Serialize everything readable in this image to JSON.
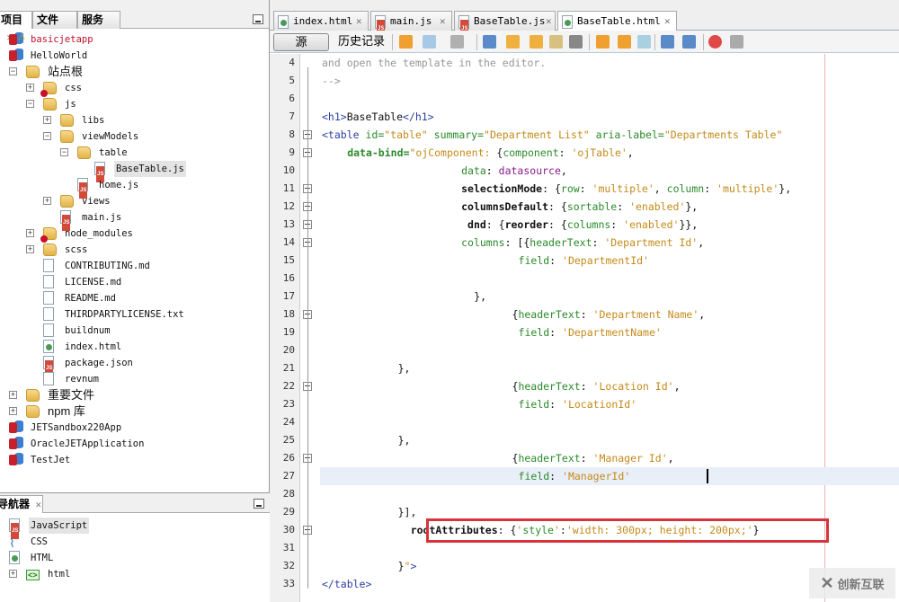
{
  "project_panel": {
    "tabs": [
      {
        "label": "项目",
        "closable": true
      },
      {
        "label": "文件"
      },
      {
        "label": "服务"
      }
    ],
    "minimize_icon": "minimize-icon",
    "tree": [
      {
        "label": "basicjetapp",
        "icon": "project-warning-icon",
        "depth": 0,
        "style": "red",
        "toggle": "+"
      },
      {
        "label": "HelloWorld",
        "icon": "project-icon",
        "depth": 0,
        "toggle": "-"
      },
      {
        "label": "站点根",
        "icon": "site-root-folder-icon",
        "depth": 1,
        "toggle": "-",
        "cn": true
      },
      {
        "label": "css",
        "icon": "folder-error-icon",
        "depth": 2,
        "toggle": "+"
      },
      {
        "label": "js",
        "icon": "folder-icon",
        "depth": 2,
        "toggle": "-"
      },
      {
        "label": "libs",
        "icon": "folder-icon",
        "depth": 3,
        "toggle": "+"
      },
      {
        "label": "viewModels",
        "icon": "folder-icon",
        "depth": 3,
        "toggle": "-"
      },
      {
        "label": "table",
        "icon": "folder-icon",
        "depth": 4,
        "toggle": "-"
      },
      {
        "label": "BaseTable.js",
        "icon": "js-file-icon",
        "depth": 5,
        "selected": true
      },
      {
        "label": "home.js",
        "icon": "js-file-icon",
        "depth": 4
      },
      {
        "label": "views",
        "icon": "folder-icon",
        "depth": 3,
        "toggle": "+"
      },
      {
        "label": "main.js",
        "icon": "js-file-icon",
        "depth": 3
      },
      {
        "label": "node_modules",
        "icon": "folder-error-icon",
        "depth": 2,
        "toggle": "+"
      },
      {
        "label": "scss",
        "icon": "folder-icon",
        "depth": 2,
        "toggle": "+"
      },
      {
        "label": "CONTRIBUTING.md",
        "icon": "file-icon",
        "depth": 2
      },
      {
        "label": "LICENSE.md",
        "icon": "file-icon",
        "depth": 2
      },
      {
        "label": "README.md",
        "icon": "file-icon",
        "depth": 2
      },
      {
        "label": "THIRDPARTYLICENSE.txt",
        "icon": "file-icon",
        "depth": 2
      },
      {
        "label": "buildnum",
        "icon": "file-icon",
        "depth": 2
      },
      {
        "label": "index.html",
        "icon": "html-file-icon",
        "depth": 2
      },
      {
        "label": "package.json",
        "icon": "js-file-icon",
        "depth": 2
      },
      {
        "label": "revnum",
        "icon": "file-icon",
        "depth": 2
      },
      {
        "label": "重要文件",
        "icon": "important-files-icon",
        "depth": 1,
        "toggle": "+",
        "cn": true
      },
      {
        "label": "npm 库",
        "icon": "npm-library-icon",
        "depth": 1,
        "toggle": "+",
        "cn": true
      },
      {
        "label": "JETSandbox220App",
        "icon": "project-icon",
        "depth": 0,
        "toggle": "+"
      },
      {
        "label": "OracleJETApplication",
        "icon": "project-icon",
        "depth": 0,
        "toggle": "+"
      },
      {
        "label": "TestJet",
        "icon": "project-icon",
        "depth": 0,
        "toggle": "+"
      }
    ]
  },
  "navigator_panel": {
    "tab": {
      "label": "导航器",
      "closable": true
    },
    "tree": [
      {
        "label": "JavaScript",
        "icon": "js-file-icon",
        "depth": 0,
        "selected": true
      },
      {
        "label": "CSS",
        "icon": "css-icon",
        "depth": 0
      },
      {
        "label": "HTML",
        "icon": "html-file-icon",
        "depth": 0
      },
      {
        "label": "html",
        "icon": "html-element-icon",
        "depth": 1,
        "toggle": "+"
      }
    ]
  },
  "editor": {
    "tabs": [
      {
        "label": "index.html",
        "icon": "html-file-icon"
      },
      {
        "label": "main.js",
        "icon": "js-file-icon"
      },
      {
        "label": "BaseTable.js",
        "icon": "js-file-icon"
      },
      {
        "label": "BaseTable.html",
        "icon": "html-file-icon",
        "active": true
      }
    ],
    "toolbar": {
      "source_label": "源",
      "history_label": "历史记录",
      "icons": [
        "last-edit-icon",
        "back-icon",
        "forward-icon",
        "find-icon",
        "find-previous-icon",
        "find-next-icon",
        "toggle-highlight-icon",
        "toggle-rect-select-icon",
        "previous-bookmark-icon",
        "next-bookmark-icon",
        "toggle-bookmark-icon",
        "shift-left-icon",
        "shift-right-icon",
        "record-macro-icon",
        "stop-macro-icon"
      ]
    },
    "current_line": 27,
    "lines": [
      {
        "n": 4,
        "tokens": [
          [
            "c-cmt",
            "and open the template in the editor."
          ]
        ]
      },
      {
        "n": 5,
        "tokens": [
          [
            "c-cmt",
            "-->"
          ]
        ]
      },
      {
        "n": 6,
        "tokens": []
      },
      {
        "n": 7,
        "tokens": [
          [
            "c-tag",
            "<h1>"
          ],
          [
            "c-black",
            "BaseTable"
          ],
          [
            "c-tag",
            "</h1>"
          ]
        ]
      },
      {
        "n": 8,
        "tokens": [
          [
            "c-tag",
            "<table "
          ],
          [
            "c-attr",
            "id="
          ],
          [
            "c-str",
            "\"table\" "
          ],
          [
            "c-attr",
            "summary="
          ],
          [
            "c-str",
            "\"Department List\" "
          ],
          [
            "c-attr",
            "aria-label="
          ],
          [
            "c-str",
            "\"Departments Table\""
          ]
        ]
      },
      {
        "n": 9,
        "indent": 4,
        "tokens": [
          [
            "c-bold c-green",
            "data-bind="
          ],
          [
            "c-str",
            "\"ojComponent: "
          ],
          [
            "c-black",
            "{"
          ],
          [
            "c-green",
            "component"
          ],
          [
            "c-black",
            ": "
          ],
          [
            "c-str",
            "'ojTable'"
          ],
          [
            "c-black",
            ","
          ]
        ]
      },
      {
        "n": 10,
        "indent": 22,
        "tokens": [
          [
            "c-green",
            "data"
          ],
          [
            "c-black",
            ": "
          ],
          [
            "c-purple",
            "datasource"
          ],
          [
            "c-black",
            ","
          ]
        ]
      },
      {
        "n": 11,
        "indent": 22,
        "tokens": [
          [
            "c-bold",
            "selectionMode"
          ],
          [
            "c-black",
            ": {"
          ],
          [
            "c-green",
            "row"
          ],
          [
            "c-black",
            ": "
          ],
          [
            "c-str",
            "'multiple'"
          ],
          [
            "c-black",
            ", "
          ],
          [
            "c-green",
            "column"
          ],
          [
            "c-black",
            ": "
          ],
          [
            "c-str",
            "'multiple'"
          ],
          [
            "c-black",
            "},"
          ]
        ]
      },
      {
        "n": 12,
        "indent": 22,
        "tokens": [
          [
            "c-bold",
            "columnsDefault"
          ],
          [
            "c-black",
            ": {"
          ],
          [
            "c-green",
            "sortable"
          ],
          [
            "c-black",
            ": "
          ],
          [
            "c-str",
            "'enabled'"
          ],
          [
            "c-black",
            "},"
          ]
        ]
      },
      {
        "n": 13,
        "indent": 22,
        "tokens": [
          [
            "c-bold",
            " dnd"
          ],
          [
            "c-black",
            ": {"
          ],
          [
            "c-bold",
            "reorder"
          ],
          [
            "c-black",
            ": {"
          ],
          [
            "c-green",
            "columns"
          ],
          [
            "c-black",
            ": "
          ],
          [
            "c-str",
            "'enabled'"
          ],
          [
            "c-black",
            "}},"
          ]
        ]
      },
      {
        "n": 14,
        "indent": 22,
        "tokens": [
          [
            "c-green",
            "columns"
          ],
          [
            "c-black",
            ": [{"
          ],
          [
            "c-green",
            "headerText"
          ],
          [
            "c-black",
            ": "
          ],
          [
            "c-str",
            "'Department Id'"
          ],
          [
            "c-black",
            ","
          ]
        ]
      },
      {
        "n": 15,
        "indent": 31,
        "tokens": [
          [
            "c-green",
            "field"
          ],
          [
            "c-black",
            ": "
          ],
          [
            "c-str",
            "'DepartmentId'"
          ]
        ]
      },
      {
        "n": 16,
        "tokens": []
      },
      {
        "n": 17,
        "indent": 24,
        "tokens": [
          [
            "c-black",
            "},"
          ]
        ]
      },
      {
        "n": 18,
        "indent": 30,
        "tokens": [
          [
            "c-black",
            "{"
          ],
          [
            "c-green",
            "headerText"
          ],
          [
            "c-black",
            ": "
          ],
          [
            "c-str",
            "'Department Name'"
          ],
          [
            "c-black",
            ","
          ]
        ]
      },
      {
        "n": 19,
        "indent": 31,
        "tokens": [
          [
            "c-green",
            "field"
          ],
          [
            "c-black",
            ": "
          ],
          [
            "c-str",
            "'DepartmentName'"
          ]
        ]
      },
      {
        "n": 20,
        "tokens": []
      },
      {
        "n": 21,
        "indent": 12,
        "tokens": [
          [
            "c-black",
            "},"
          ]
        ]
      },
      {
        "n": 22,
        "indent": 30,
        "tokens": [
          [
            "c-black",
            "{"
          ],
          [
            "c-green",
            "headerText"
          ],
          [
            "c-black",
            ": "
          ],
          [
            "c-str",
            "'Location Id'"
          ],
          [
            "c-black",
            ","
          ]
        ]
      },
      {
        "n": 23,
        "indent": 31,
        "tokens": [
          [
            "c-green",
            "field"
          ],
          [
            "c-black",
            ": "
          ],
          [
            "c-str",
            "'LocationId'"
          ]
        ]
      },
      {
        "n": 24,
        "tokens": []
      },
      {
        "n": 25,
        "indent": 12,
        "tokens": [
          [
            "c-black",
            "},"
          ]
        ]
      },
      {
        "n": 26,
        "indent": 30,
        "tokens": [
          [
            "c-black",
            "{"
          ],
          [
            "c-green",
            "headerText"
          ],
          [
            "c-black",
            ": "
          ],
          [
            "c-str",
            "'Manager Id'"
          ],
          [
            "c-black",
            ","
          ]
        ]
      },
      {
        "n": 27,
        "indent": 31,
        "tokens": [
          [
            "c-green",
            "field"
          ],
          [
            "c-black",
            ": "
          ],
          [
            "c-str",
            "'ManagerId'"
          ]
        ]
      },
      {
        "n": 28,
        "tokens": []
      },
      {
        "n": 29,
        "indent": 12,
        "tokens": [
          [
            "c-black",
            "}],"
          ]
        ]
      },
      {
        "n": 30,
        "indent": 14,
        "tokens": [
          [
            "c-bold",
            "rootAttributes"
          ],
          [
            "c-black",
            ": {"
          ],
          [
            "c-str",
            "'"
          ],
          [
            "c-green",
            "style"
          ],
          [
            "c-str",
            "'"
          ],
          [
            "c-black",
            ":"
          ],
          [
            "c-str",
            "'width: 300px; height: 200px;'"
          ],
          [
            "c-black",
            "}"
          ]
        ]
      },
      {
        "n": 31,
        "tokens": []
      },
      {
        "n": 32,
        "indent": 12,
        "tokens": [
          [
            "c-black",
            "}"
          ],
          [
            "c-str",
            "\""
          ],
          [
            "c-tag",
            ">"
          ]
        ]
      },
      {
        "n": 33,
        "tokens": [
          [
            "c-tag",
            "</table>"
          ]
        ]
      }
    ],
    "folds": [
      8,
      9,
      11,
      12,
      13,
      14,
      18,
      22,
      26,
      30
    ],
    "highlighted_line": 30
  },
  "watermark": {
    "label": "创新互联"
  }
}
